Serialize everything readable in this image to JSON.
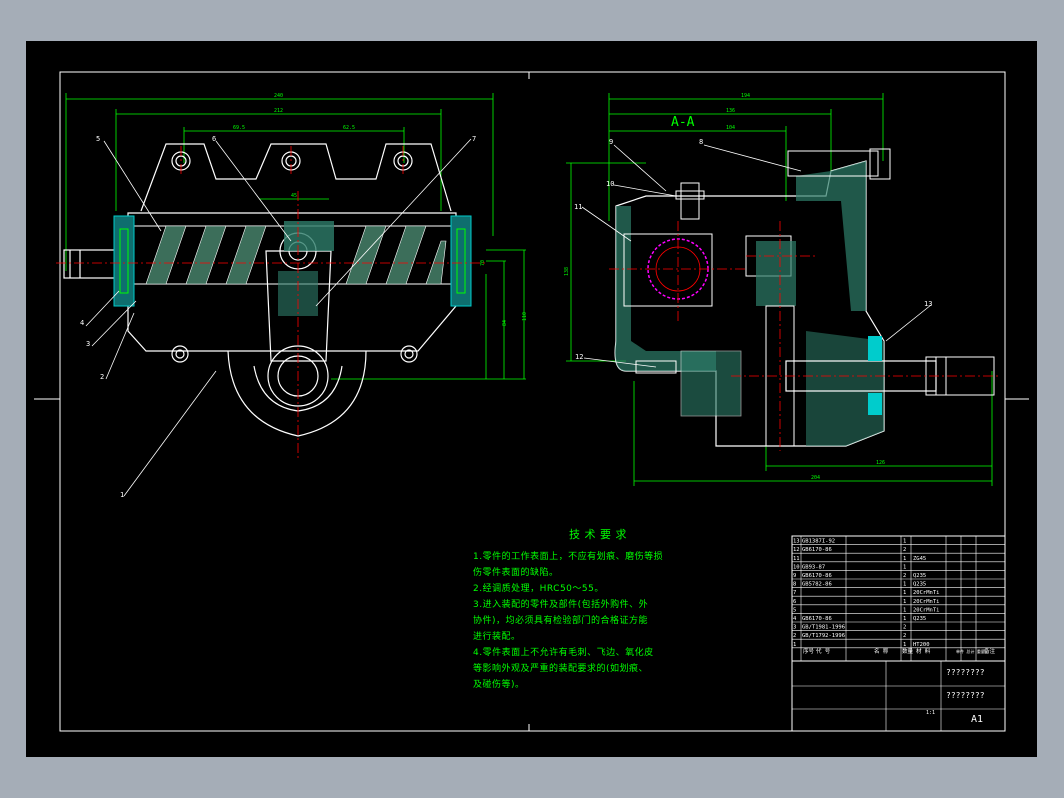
{
  "colors": {
    "background": "#a5adb7",
    "sheet": "#000000",
    "outline": "#ffffff",
    "section": "#00ff00",
    "dimension": "#00ff00",
    "center_line": "#ff0000",
    "hatch": "#00aa88",
    "callout": "#ffffff",
    "accent_cyan": "#00cccc",
    "accent_magenta": "#ff00ff"
  },
  "drawing": {
    "section_label": "A-A",
    "left_view": {
      "dims_top": [
        "240",
        "212",
        "69.5",
        "62.5",
        "45"
      ],
      "dims_right": [
        "110",
        "84",
        "70"
      ],
      "callouts": [
        "5",
        "6",
        "7",
        "4",
        "3",
        "2",
        "1"
      ]
    },
    "right_view": {
      "dims_top": [
        "194",
        "136",
        "104"
      ],
      "dims_left": [
        "138"
      ],
      "dims_bottom": [
        "204",
        "126"
      ],
      "callouts": [
        "9",
        "8",
        "10",
        "11",
        "12",
        "13"
      ]
    }
  },
  "tech_req": {
    "title": "技 术 要 求",
    "lines": [
      "1.零件的工作表面上，不应有划痕、磨伤等损",
      "伤零件表面的缺陷。",
      "2.经调质处理，HRC50～55。",
      "3.进入装配的零件及部件(包括外购件、外",
      "协件)，均必须具有检验部门的合格证方能",
      "进行装配。",
      "4.零件表面上不允许有毛刺、飞边、氧化皮",
      "等影响外观及严重的装配要求的(如划痕、",
      "及碰伤等)。"
    ]
  },
  "bom": {
    "rows": [
      {
        "no": "13",
        "code": "GB1387I-92",
        "qty": "1",
        "mat": ""
      },
      {
        "no": "12",
        "code": "GB6170-86",
        "qty": "2",
        "mat": ""
      },
      {
        "no": "11",
        "code": "",
        "qty": "1",
        "mat": "ZG45"
      },
      {
        "no": "10",
        "code": "GB93-87",
        "qty": "1",
        "mat": ""
      },
      {
        "no": "9",
        "code": "GB6170-86",
        "qty": "2",
        "mat": "Q235"
      },
      {
        "no": "8",
        "code": "GB5782-86",
        "qty": "1",
        "mat": "Q235"
      },
      {
        "no": "7",
        "code": "",
        "qty": "1",
        "mat": "20CrMnTi"
      },
      {
        "no": "6",
        "code": "",
        "qty": "1",
        "mat": "20CrMnTi"
      },
      {
        "no": "5",
        "code": "",
        "qty": "1",
        "mat": "20CrMnTi"
      },
      {
        "no": "4",
        "code": "GB6170-86",
        "qty": "1",
        "mat": "Q235"
      },
      {
        "no": "3",
        "code": "GB/T1981-1996",
        "qty": "2",
        "mat": ""
      },
      {
        "no": "2",
        "code": "GB/T1792-1996",
        "qty": "2",
        "mat": ""
      },
      {
        "no": "1",
        "code": "",
        "qty": "1",
        "mat": "HT200"
      }
    ],
    "header": {
      "no": "序号",
      "code": "代 号",
      "name": "名 称",
      "qty": "数量",
      "mat": "材 料",
      "weight": "单件 总计 重量",
      "note": "备注"
    },
    "title_block": {
      "title1": "????????",
      "title2": "????????",
      "sheet_size": "A1",
      "scale": "1:1"
    }
  }
}
